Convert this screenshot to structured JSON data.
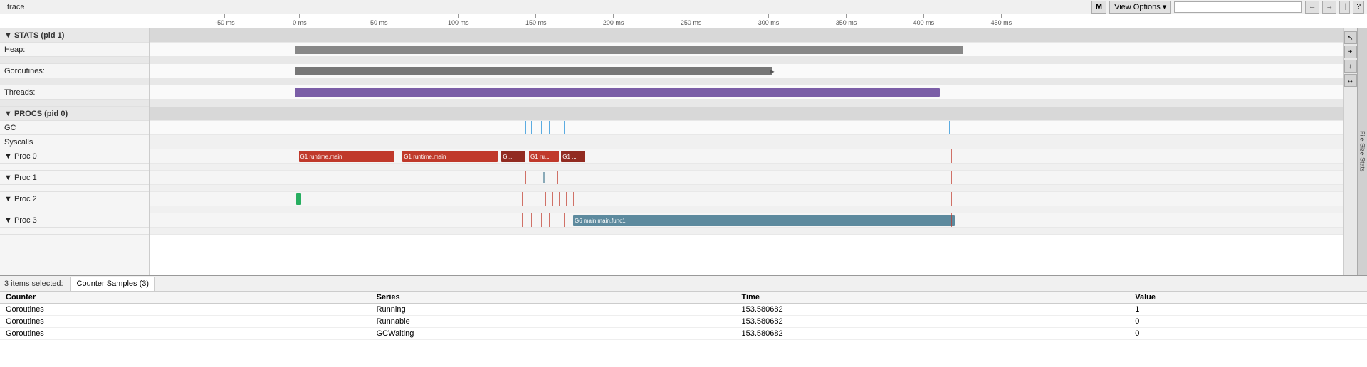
{
  "toolbar": {
    "app_title": "trace",
    "m_button": "M",
    "view_options_label": "View Options",
    "view_options_arrow": "▾",
    "search_placeholder": "",
    "nav_back": "←",
    "nav_forward": "→",
    "nav_pipe": "||",
    "nav_question": "?"
  },
  "ruler": {
    "ticks": [
      {
        "label": "-50 ms",
        "pct": 5.5
      },
      {
        "label": "0 ms",
        "pct": 12.0
      },
      {
        "label": "50 ms",
        "pct": 18.5
      },
      {
        "label": "100 ms",
        "pct": 25.0
      },
      {
        "label": "150 ms",
        "pct": 31.5
      },
      {
        "label": "200 ms",
        "pct": 38.0
      },
      {
        "label": "250 ms",
        "pct": 44.5
      },
      {
        "label": "300 ms",
        "pct": 51.0
      },
      {
        "label": "350 ms",
        "pct": 57.5
      },
      {
        "label": "400 ms",
        "pct": 64.0
      },
      {
        "label": "450 ms",
        "pct": 70.5
      }
    ]
  },
  "labels": [
    {
      "text": "▼ STATS (pid 1)",
      "type": "section-header"
    },
    {
      "text": "Heap:",
      "type": "normal"
    },
    {
      "text": "",
      "type": "spacer"
    },
    {
      "text": "Goroutines:",
      "type": "normal"
    },
    {
      "text": "",
      "type": "spacer"
    },
    {
      "text": "Threads:",
      "type": "normal"
    },
    {
      "text": "",
      "type": "spacer"
    },
    {
      "text": "▼ PROCS (pid 0)",
      "type": "section-header"
    },
    {
      "text": "GC",
      "type": "normal"
    },
    {
      "text": "Syscalls",
      "type": "normal"
    },
    {
      "text": "▼ Proc 0",
      "type": "normal"
    },
    {
      "text": "",
      "type": "spacer"
    },
    {
      "text": "▼ Proc 1",
      "type": "normal"
    },
    {
      "text": "",
      "type": "spacer"
    },
    {
      "text": "▼ Proc 2",
      "type": "normal"
    },
    {
      "text": "",
      "type": "spacer"
    },
    {
      "text": "▼ Proc 3",
      "type": "normal"
    },
    {
      "text": "",
      "type": "spacer"
    }
  ],
  "bottom": {
    "items_selected": "3 items selected:",
    "tab_label": "Counter Samples (3)",
    "table_headers": [
      "Counter",
      "Series",
      "Time",
      "Value"
    ],
    "table_rows": [
      {
        "counter": "Goroutines",
        "series": "Running",
        "time": "153.580682",
        "value": "1"
      },
      {
        "counter": "Goroutines",
        "series": "Runnable",
        "time": "153.580682",
        "value": "0"
      },
      {
        "counter": "Goroutines",
        "series": "GCWaiting",
        "time": "153.580682",
        "value": "0"
      }
    ]
  },
  "tools": {
    "pointer": "↖",
    "zoom_in": "+",
    "zoom_out": "↓",
    "fit": "↔"
  },
  "far_right": {
    "label": "File Size Stats"
  }
}
